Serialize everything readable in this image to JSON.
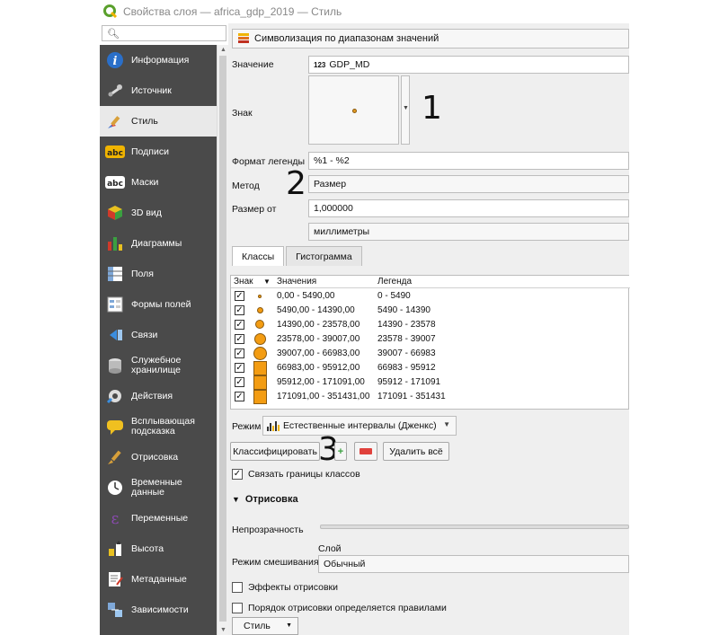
{
  "window": {
    "title": "Свойства слоя — africa_gdp_2019 — Стиль"
  },
  "search": {
    "placeholder": ""
  },
  "sidebar": {
    "items": [
      {
        "label": "Информация",
        "icon": "info-icon"
      },
      {
        "label": "Источник",
        "icon": "source-wrench-icon"
      },
      {
        "label": "Стиль",
        "icon": "brush-icon"
      },
      {
        "label": "Подписи",
        "icon": "labels-abc-icon"
      },
      {
        "label": "Маски",
        "icon": "masks-abc-icon"
      },
      {
        "label": "3D вид",
        "icon": "cube-3d-icon"
      },
      {
        "label": "Диаграммы",
        "icon": "diagrams-icon"
      },
      {
        "label": "Поля",
        "icon": "fields-icon"
      },
      {
        "label": "Формы полей",
        "icon": "attribute-form-icon"
      },
      {
        "label": "Связи",
        "icon": "joins-icon"
      },
      {
        "label_line1": "Служебное",
        "label_line2": "хранилище",
        "icon": "auxiliary-storage-icon"
      },
      {
        "label": "Действия",
        "icon": "actions-gear-icon"
      },
      {
        "label_line1": "Всплывающая",
        "label_line2": "подсказка",
        "icon": "map-tip-icon"
      },
      {
        "label": "Отрисовка",
        "icon": "rendering-brush-icon"
      },
      {
        "label_line1": "Временные",
        "label_line2": "данные",
        "icon": "temporal-clock-icon"
      },
      {
        "label": "Переменные",
        "icon": "variables-epsilon-icon"
      },
      {
        "label": "Высота",
        "icon": "elevation-icon"
      },
      {
        "label": "Метаданные",
        "icon": "metadata-icon"
      },
      {
        "label": "Зависимости",
        "icon": "dependencies-icon"
      }
    ],
    "active_index": 2
  },
  "renderer": {
    "label": "Символизация по диапазонам значений"
  },
  "form": {
    "value_label": "Значение",
    "value_badge": "123",
    "value": "GDP_MD",
    "symbol_label": "Знак",
    "legend_format_label": "Формат легенды",
    "legend_format": "%1 - %2",
    "method_label": "Метод",
    "method": "Размер",
    "size_from_label": "Размер от",
    "size_from": "1,000000",
    "units": "миллиметры"
  },
  "annotations": [
    "1",
    "2",
    "3"
  ],
  "tabs": [
    {
      "label": "Классы"
    },
    {
      "label": "Гистограмма"
    }
  ],
  "classes": {
    "headers": {
      "symbol": "Знак",
      "values": "Значения",
      "legend": "Легенда"
    },
    "rows": [
      {
        "checked": "✓",
        "values": "0,00 - 5490,00",
        "legend": "0 - 5490"
      },
      {
        "checked": "✓",
        "values": "5490,00 - 14390,00",
        "legend": "5490 - 14390"
      },
      {
        "checked": "✓",
        "values": "14390,00 - 23578,00",
        "legend": "14390 - 23578"
      },
      {
        "checked": "✓",
        "values": "23578,00 - 39007,00",
        "legend": "23578 - 39007"
      },
      {
        "checked": "✓",
        "values": "39007,00 - 66983,00",
        "legend": "39007 - 66983"
      },
      {
        "checked": "✓",
        "values": "66983,00 - 95912,00",
        "legend": "66983 - 95912"
      },
      {
        "checked": "✓",
        "values": "95912,00 - 171091,00",
        "legend": "95912 - 171091"
      },
      {
        "checked": "✓",
        "values": "171091,00 - 351431,00",
        "legend": "171091 - 351431"
      }
    ]
  },
  "mode": {
    "label": "Режим",
    "value": "Естественные интервалы (Дженкс)"
  },
  "buttons": {
    "classify": "Классифицировать",
    "delete_all": "Удалить всё"
  },
  "link_class_bounds": {
    "checked": "✓",
    "label": "Связать границы классов"
  },
  "rendering": {
    "section_title": "Отрисовка",
    "opacity_label": "Непрозрачность",
    "blend_label": "Режим смешивания",
    "layer_label": "Слой",
    "blend_value": "Обычный",
    "effects_label": "Эффекты отрисовки",
    "order_label": "Порядок отрисовки определяется правилами"
  },
  "footer": {
    "style_button": "Стиль"
  },
  "colors": {
    "symbol_fill": "#f39c12",
    "sidebar_bg": "#4a4a4a",
    "accent_red": "#e0413c"
  }
}
